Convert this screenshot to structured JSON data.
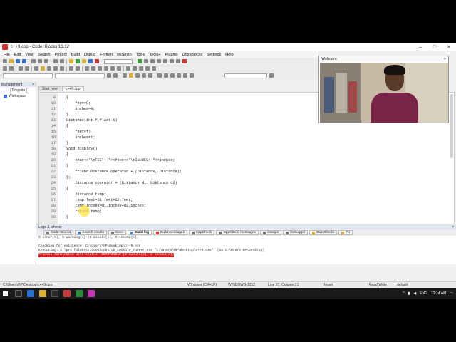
{
  "window": {
    "title": "c++9.cpp - Code::Blocks 13.12",
    "min": "–",
    "max": "□",
    "close": "✕"
  },
  "menu": [
    "File",
    "Edit",
    "View",
    "Search",
    "Project",
    "Build",
    "Debug",
    "Fortran",
    "wxSmith",
    "Tools",
    "Tools+",
    "Plugins",
    "DoxyBlocks",
    "Settings",
    "Help"
  ],
  "management": {
    "title": "Management",
    "close": "×",
    "tab": "Projects",
    "workspace": "Workspace"
  },
  "editor": {
    "tabs": [
      "Start here",
      "c++9.cpp"
    ],
    "lines": [
      {
        "n": "9",
        "code": "{"
      },
      {
        "n": "10",
        "code": "    feet=0;"
      },
      {
        "n": "11",
        "code": "    inches=0;"
      },
      {
        "n": "12",
        "code": "}"
      },
      {
        "n": "13",
        "code": "Distance(int f,float i)"
      },
      {
        "n": "14",
        "code": "{"
      },
      {
        "n": "15",
        "code": "    feet=f;"
      },
      {
        "n": "16",
        "code": "    inches=i;"
      },
      {
        "n": "17",
        "code": "}"
      },
      {
        "n": "18",
        "code": "void display()"
      },
      {
        "n": "19",
        "code": "{"
      },
      {
        "n": "20",
        "code": "    cout<<\"\\nFEET: \"<<feet<<\"\\tINCHES: \"<<inches;"
      },
      {
        "n": "21",
        "code": "}"
      },
      {
        "n": "22",
        "code": "    friend Distance operator + (Distance, Distance);"
      },
      {
        "n": "23",
        "code": "};"
      },
      {
        "n": "24",
        "code": "    Distance operator + (Distance d1, Distance d2)"
      },
      {
        "n": "25",
        "code": "{"
      },
      {
        "n": "26",
        "code": "    Distance temp;"
      },
      {
        "n": "27",
        "code": "    temp.feet=d1.feet+d2.feet;"
      },
      {
        "n": "28",
        "code": "    temp.inches=d1.inches+d2.inches;"
      },
      {
        "n": "29",
        "code": "    return temp;"
      },
      {
        "n": "30",
        "code": "}"
      }
    ]
  },
  "webcam": {
    "title": "Webcam",
    "close": "×"
  },
  "logs": {
    "title": "Logs & others",
    "close": "×",
    "tabs": [
      "Code::Blocks",
      "Search results",
      "Cccc",
      "Build log",
      "Build messages",
      "CppCheck",
      "CppCheck messages",
      "Cscope",
      "Debugger",
      "DoxyBlocks",
      "Fo"
    ],
    "lines": [
      "0 error(s), 0 warning(s) (0 minute(s), 0 second(s))",
      "",
      "Checking for existence: C:\\Users\\HP\\Desktop\\c++9.exe",
      "Executing: C:\\pro folders\\CodeBlocks/cb_console_runner.exe \"C:\\Users\\HP\\Desktop\\c++9.exe\"  (in C:\\Users\\HP\\Desktop)"
    ],
    "error_line": "Process terminated with status -1073741510 (0 minute(s), 2 second(s))"
  },
  "status": {
    "path": "C:\\Users\\HP\\Desktop\\c++9.cpp",
    "eol": "Windows (CR+LF)",
    "encoding": "WINDOWS-1252",
    "position": "Line 27, Column 21",
    "mode": "Insert",
    "access": "Read/Write",
    "profile": "default"
  },
  "taskbar": {
    "lang": "ENG",
    "time": "12:14 AM"
  }
}
